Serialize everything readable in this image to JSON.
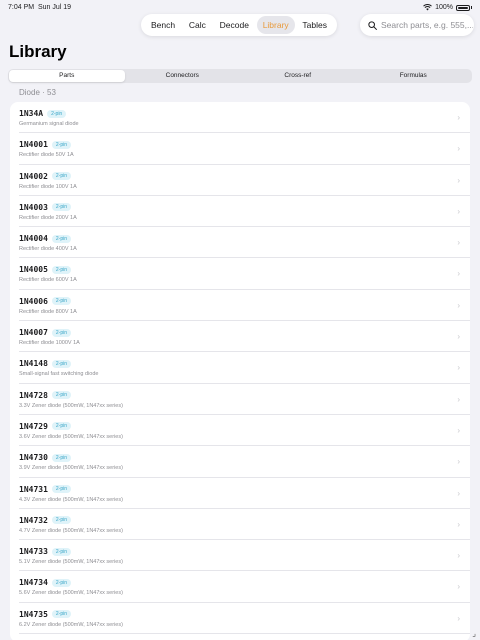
{
  "status": {
    "time": "7:04 PM",
    "date": "Sun Jul 19",
    "battery": "100%"
  },
  "nav": {
    "items": [
      {
        "label": "Bench",
        "active": false
      },
      {
        "label": "Calc",
        "active": false
      },
      {
        "label": "Decode",
        "active": false
      },
      {
        "label": "Library",
        "active": true
      },
      {
        "label": "Tables",
        "active": false
      }
    ]
  },
  "search": {
    "placeholder": "Search parts, e.g. 555,..."
  },
  "page": {
    "title": "Library"
  },
  "segments": [
    {
      "label": "Parts",
      "active": true
    },
    {
      "label": "Connectors",
      "active": false
    },
    {
      "label": "Cross-ref",
      "active": false
    },
    {
      "label": "Formulas",
      "active": false
    }
  ],
  "section": {
    "header": "Diode · 53"
  },
  "parts": [
    {
      "name": "1N34A",
      "pins": "2-pin",
      "desc": "Germanium signal diode"
    },
    {
      "name": "1N4001",
      "pins": "2-pin",
      "desc": "Rectifier diode 50V 1A"
    },
    {
      "name": "1N4002",
      "pins": "2-pin",
      "desc": "Rectifier diode 100V 1A"
    },
    {
      "name": "1N4003",
      "pins": "2-pin",
      "desc": "Rectifier diode 200V 1A"
    },
    {
      "name": "1N4004",
      "pins": "2-pin",
      "desc": "Rectifier diode 400V 1A"
    },
    {
      "name": "1N4005",
      "pins": "2-pin",
      "desc": "Rectifier diode 600V 1A"
    },
    {
      "name": "1N4006",
      "pins": "2-pin",
      "desc": "Rectifier diode 800V 1A"
    },
    {
      "name": "1N4007",
      "pins": "2-pin",
      "desc": "Rectifier diode 1000V 1A"
    },
    {
      "name": "1N4148",
      "pins": "2-pin",
      "desc": "Small-signal fast switching diode"
    },
    {
      "name": "1N4728",
      "pins": "2-pin",
      "desc": "3.3V Zener diode (500mW, 1N47xx series)"
    },
    {
      "name": "1N4729",
      "pins": "2-pin",
      "desc": "3.6V Zener diode (500mW, 1N47xx series)"
    },
    {
      "name": "1N4730",
      "pins": "2-pin",
      "desc": "3.9V Zener diode (500mW, 1N47xx series)"
    },
    {
      "name": "1N4731",
      "pins": "2-pin",
      "desc": "4.3V Zener diode (500mW, 1N47xx series)"
    },
    {
      "name": "1N4732",
      "pins": "2-pin",
      "desc": "4.7V Zener diode (500mW, 1N47xx series)"
    },
    {
      "name": "1N4733",
      "pins": "2-pin",
      "desc": "5.1V Zener diode (500mW, 1N47xx series)"
    },
    {
      "name": "1N4734",
      "pins": "2-pin",
      "desc": "5.6V Zener diode (500mW, 1N47xx series)"
    },
    {
      "name": "1N4735",
      "pins": "2-pin",
      "desc": "6.2V Zener diode (500mW, 1N47xx series)"
    }
  ],
  "icons": {
    "row_chevron": "chevron-right-icon",
    "search": "search-icon",
    "wifi": "wifi-icon",
    "battery": "battery-icon"
  },
  "colors": {
    "accent": "#e89a3c",
    "badge_text": "#3aa6c8",
    "badge_bg": "#dff3f9",
    "background": "#f2f2f7"
  }
}
